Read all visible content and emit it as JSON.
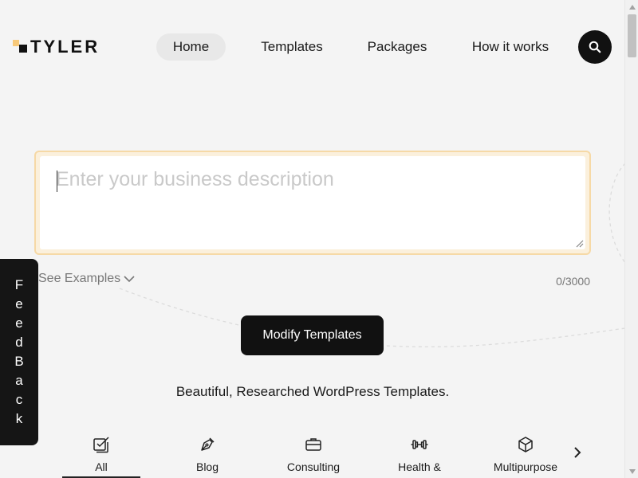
{
  "brand": {
    "name": "TYLER",
    "accent": "#f7c97a"
  },
  "nav": {
    "items": [
      {
        "label": "Home",
        "active": true
      },
      {
        "label": "Templates"
      },
      {
        "label": "Packages"
      },
      {
        "label": "How it works"
      }
    ],
    "search_icon": "search-icon"
  },
  "description": {
    "placeholder": "Enter your business description",
    "value": "",
    "see_examples": "See Examples",
    "char_count": "0/3000"
  },
  "cta": {
    "label": "Modify Templates"
  },
  "tagline": "Beautiful, Researched WordPress Templates.",
  "categories": {
    "items": [
      {
        "label": "All",
        "icon": "checklist-icon",
        "active": true
      },
      {
        "label": "Blog",
        "icon": "pen-nib-icon"
      },
      {
        "label": "Consulting",
        "icon": "briefcase-icon"
      },
      {
        "label": "Health &",
        "icon": "dumbbell-icon"
      },
      {
        "label": "Multipurpose",
        "icon": "cube-icon"
      }
    ],
    "next_icon": "chevron-right-icon"
  },
  "feedback": {
    "letters": [
      "F",
      "e",
      "e",
      "d",
      "B",
      "a",
      "c",
      "k"
    ]
  }
}
